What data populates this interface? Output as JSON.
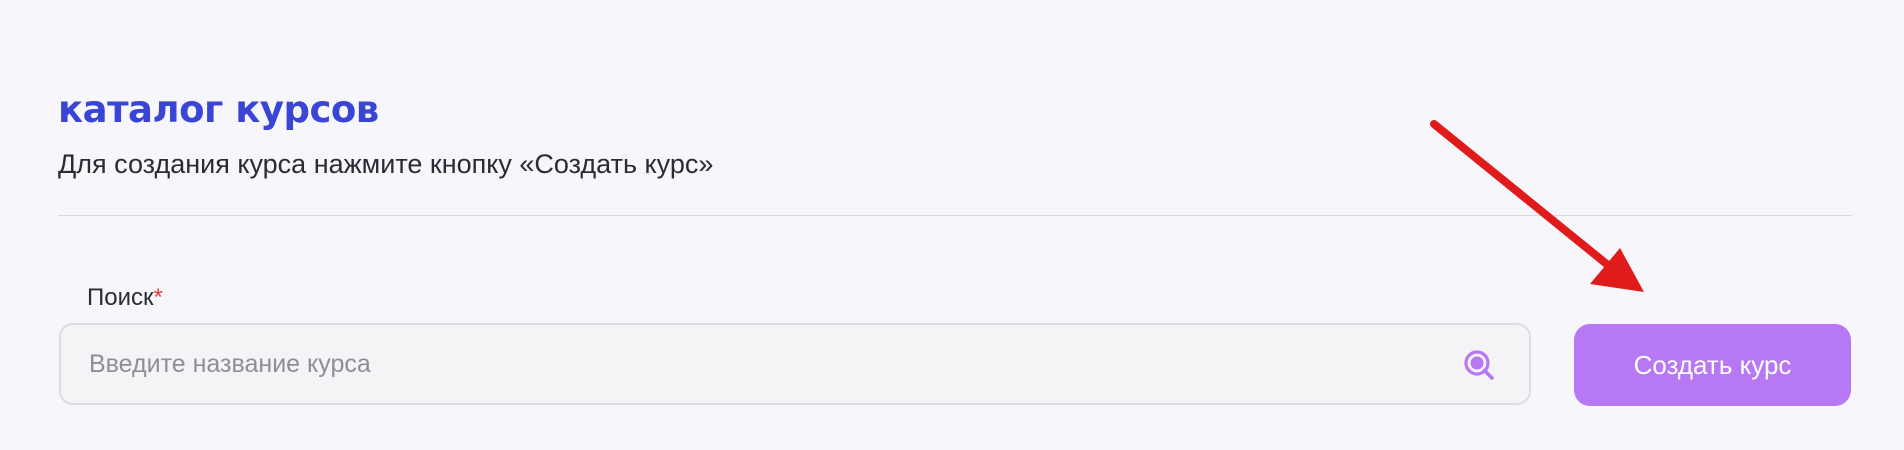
{
  "header": {
    "title": "каталог курсов",
    "subtitle": "Для создания курса нажмите кнопку «Создать курс»"
  },
  "search": {
    "label": "Поиск",
    "required_mark": "*",
    "placeholder": "Введите название курса",
    "value": "",
    "icon": "search-magnifier-icon"
  },
  "actions": {
    "create_label": "Создать курс"
  },
  "annotation": {
    "type": "arrow",
    "points_to": "create-course-button"
  },
  "colors": {
    "title": "#3a45d6",
    "button_bg": "#b778f3",
    "button_text": "#ffffff",
    "icon": "#b778f3",
    "arrow": "#e01b1b",
    "background": "#f6f6fb"
  }
}
